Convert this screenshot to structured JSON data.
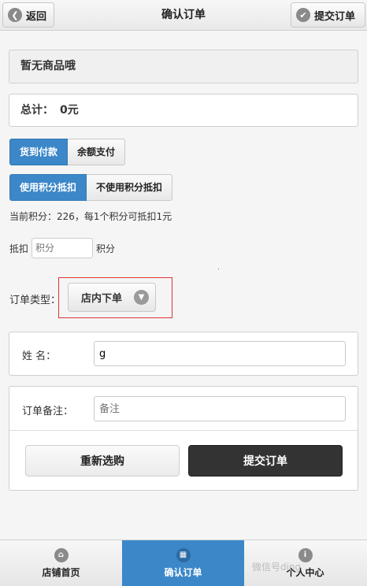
{
  "header": {
    "back_label": "返回",
    "title": "确认订单",
    "submit_label": "提交订单"
  },
  "cart": {
    "empty_text": "暂无商品哦"
  },
  "total": {
    "label": "总计：",
    "amount": "0元"
  },
  "payment": {
    "options": [
      "货到付款",
      "余额支付"
    ],
    "selected": "货到付款"
  },
  "points_mode": {
    "options": [
      "使用积分抵扣",
      "不使用积分抵扣"
    ],
    "selected": "使用积分抵扣"
  },
  "points_info": "当前积分：226，每1个积分可抵扣1元",
  "deduct": {
    "prefix": "抵扣",
    "placeholder": "积分",
    "suffix": "积分"
  },
  "order_type": {
    "label": "订单类型：",
    "value": "店内下单"
  },
  "name_field": {
    "label": "姓    名：",
    "value": "g"
  },
  "remark_field": {
    "label": "订单备注：",
    "placeholder": "备注"
  },
  "actions": {
    "reset_label": "重新选购",
    "submit_label": "提交订单"
  },
  "footer": {
    "tabs": [
      {
        "label": "店铺首页",
        "icon": "home-icon"
      },
      {
        "label": "确认订单",
        "icon": "grid-icon"
      },
      {
        "label": "个人中心",
        "icon": "info-icon"
      }
    ],
    "active": "确认订单"
  },
  "watermark": "微信号ding",
  "colors": {
    "accent": "#3b87c8",
    "dark_button": "#333333",
    "highlight_border": "#dd3333"
  }
}
